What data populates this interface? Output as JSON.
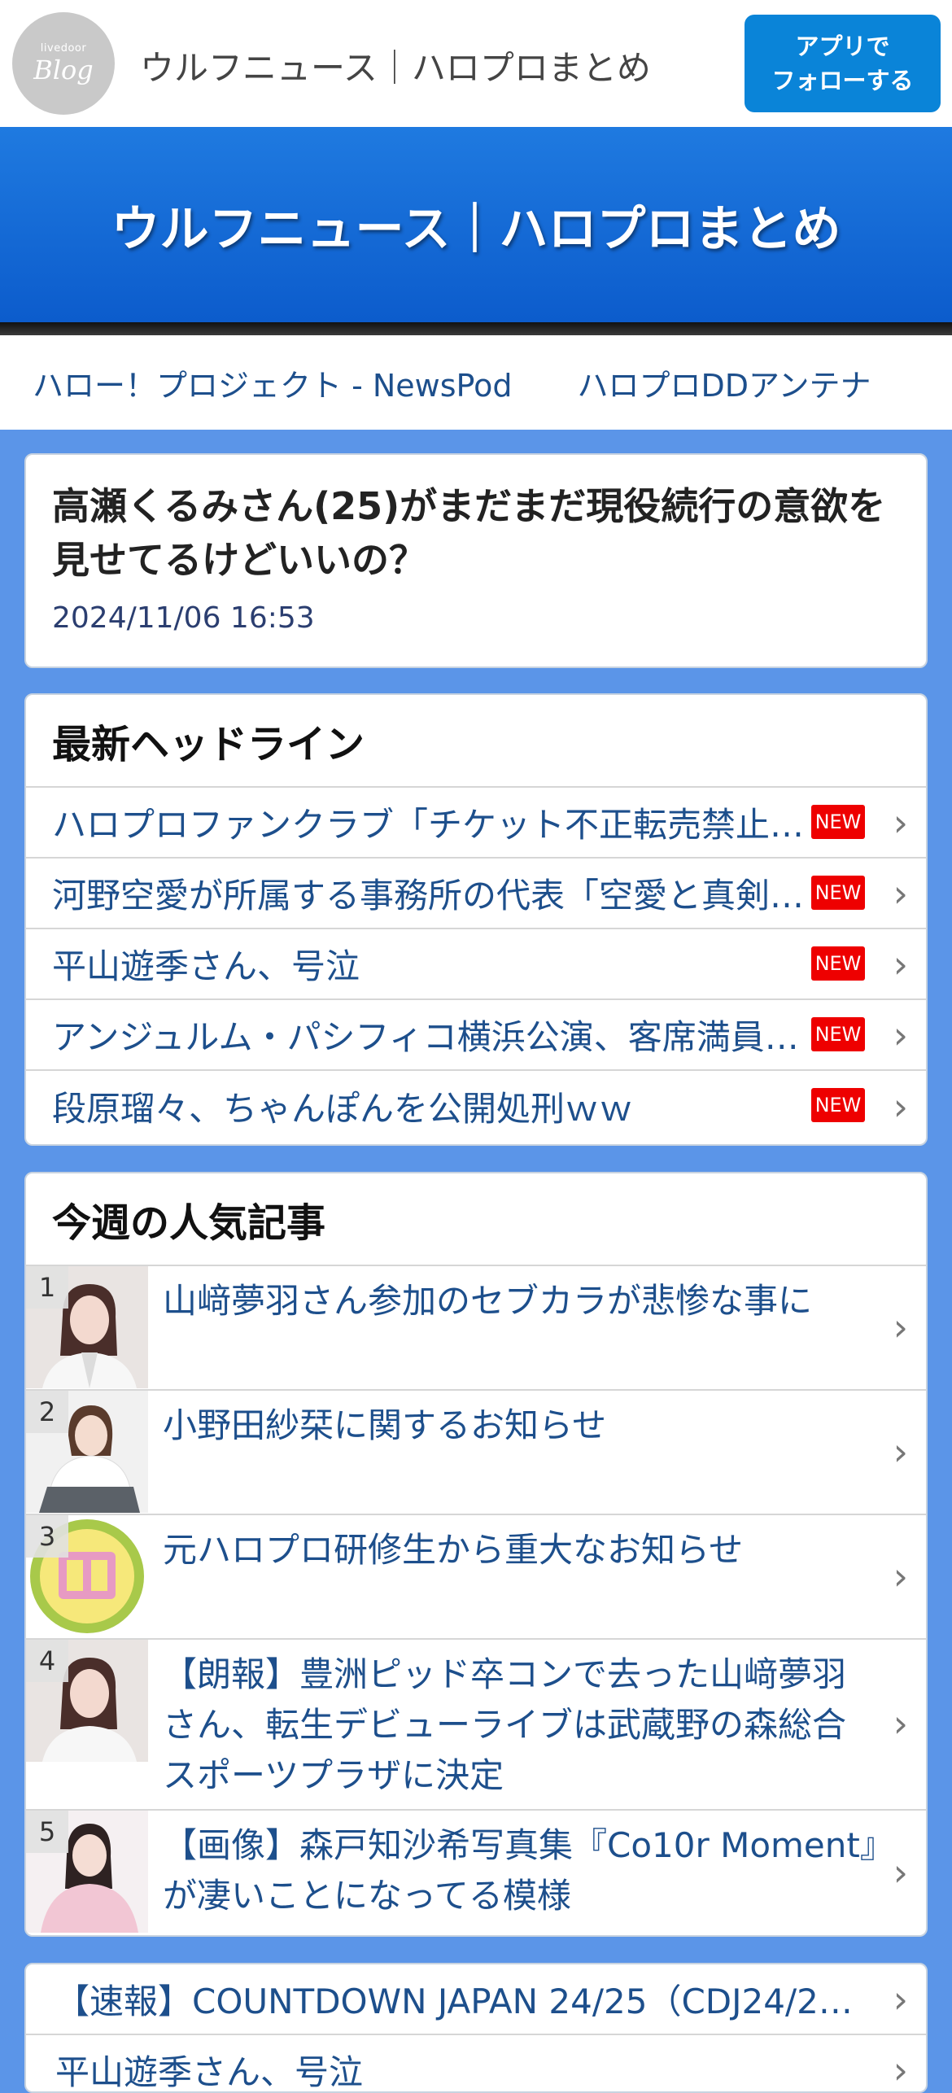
{
  "appbar": {
    "logo_small": "livedoor",
    "logo_big": "Blog",
    "title": "ウルフニュース｜ハロプロまとめ",
    "follow_line1": "アプリで",
    "follow_line2": "フォローする"
  },
  "banner": {
    "title": "ウルフニュース｜ハロプロまとめ"
  },
  "links": [
    "ハロー！プロジェクト - NewsPod",
    "ハロプロDDアンテナ"
  ],
  "article": {
    "title": "高瀬くるみさん(25)がまだまだ現役続行の意欲を見せてるけどいいの？",
    "date": "2024/11/06 16:53"
  },
  "headlines": {
    "heading": "最新ヘッドライン",
    "badge": "NEW",
    "items": [
      "ハロプロファンクラブ「チケット不正転売禁止…",
      "河野空愛が所属する事務所の代表「空愛と真剣…",
      "平山遊季さん、号泣",
      "アンジュルム・パシフィコ横浜公演、客席満員…",
      "段原瑠々、ちゃんぽんを公開処刑ｗｗ"
    ]
  },
  "popular": {
    "heading": "今週の人気記事",
    "items": [
      {
        "rank": "1",
        "text": "山﨑夢羽さん参加のセブカラが悲惨な事に"
      },
      {
        "rank": "2",
        "text": "小野田紗栞に関するお知らせ"
      },
      {
        "rank": "3",
        "text": "元ハロプロ研修生から重大なお知らせ"
      },
      {
        "rank": "4",
        "text": "【朗報】豊洲ピッド卒コンで去った山﨑夢羽さん、転生デビューライブは武蔵野の森総合スポーツプラザに決定"
      },
      {
        "rank": "5",
        "text": "【画像】森戸知沙希写真集『Co10r Moment』が凄いことになってる模様"
      }
    ]
  },
  "related": {
    "items": [
      "【速報】COUNTDOWN JAPAN 24/25（CDJ24/2…",
      "平山遊季さん、号泣"
    ]
  },
  "colors": {
    "accent": "#0a84d8",
    "banner": "#1567d6",
    "background": "#5b95e8",
    "link": "#1d4f8c",
    "new_badge": "#ee0000"
  }
}
